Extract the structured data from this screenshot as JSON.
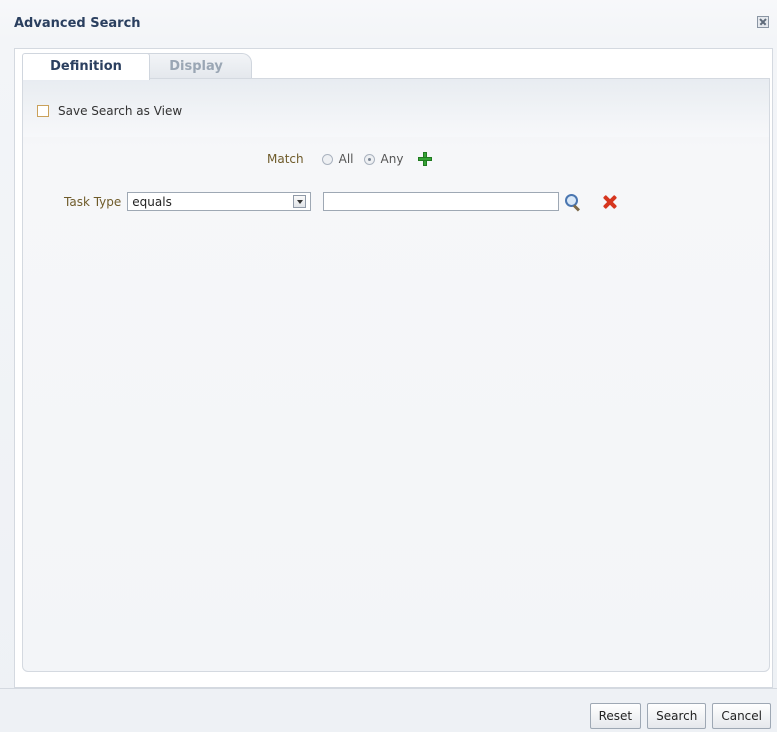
{
  "dialog": {
    "title": "Advanced Search"
  },
  "tabs": [
    {
      "label": "Definition",
      "active": true
    },
    {
      "label": "Display",
      "active": false
    }
  ],
  "save_search_view": {
    "label": "Save Search as View",
    "checked": false
  },
  "match": {
    "label": "Match",
    "options": [
      {
        "label": "All",
        "selected": false
      },
      {
        "label": "Any",
        "selected": true
      }
    ]
  },
  "criteria": [
    {
      "field_label": "Task Type",
      "operator": "equals",
      "value": ""
    }
  ],
  "buttons": {
    "reset": "Reset",
    "search": "Search",
    "cancel": "Cancel"
  },
  "icons": {
    "close": "close-icon",
    "add": "add-icon",
    "search": "search-icon",
    "delete": "delete-icon",
    "dropdown": "chevron-down-icon"
  },
  "colors": {
    "title": "#2a3f5f",
    "label": "#6f5b2a",
    "add": "#36a436",
    "delete": "#d6361f"
  }
}
